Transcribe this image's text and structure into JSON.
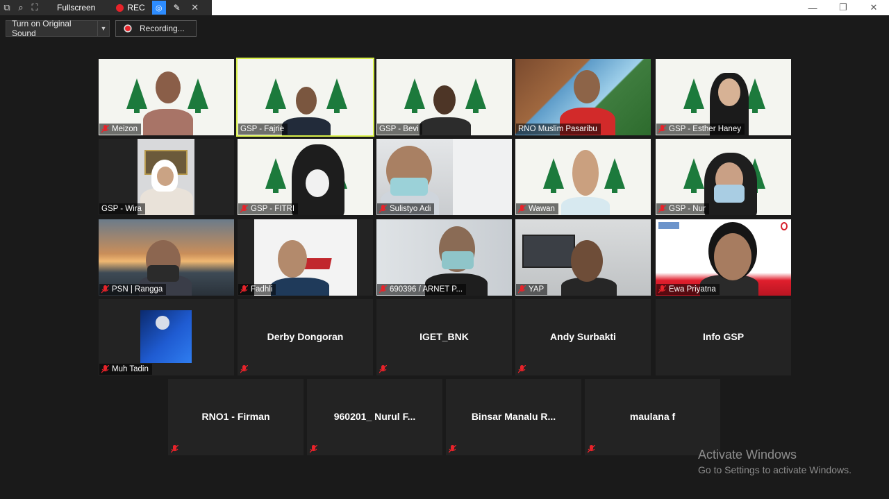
{
  "title_bar": {
    "fullscreen_label": "Fullscreen",
    "rec_label": "REC"
  },
  "toolbar": {
    "original_sound_label": "Turn on Original Sound",
    "recording_label": "Recording..."
  },
  "video_tiles": [
    {
      "name": "Meizon",
      "muted": true
    },
    {
      "name": "GSP - Fajrie",
      "muted": false,
      "active_speaker": true
    },
    {
      "name": "GSP - Bevi",
      "muted": false
    },
    {
      "name": "RNO Muslim Pasaribu",
      "muted": false
    },
    {
      "name": "GSP - Esther Haney",
      "muted": true
    },
    {
      "name": "GSP - Wira",
      "muted": false
    },
    {
      "name": "GSP - FITRI",
      "muted": true
    },
    {
      "name": "Sulistyo Adi",
      "muted": true
    },
    {
      "name": "Wawan",
      "muted": true
    },
    {
      "name": "GSP - Nur",
      "muted": true
    },
    {
      "name": "PSN | Rangga",
      "muted": true
    },
    {
      "name": "Fadhli",
      "muted": true
    },
    {
      "name": "690396 / ARNET P...",
      "muted": true
    },
    {
      "name": "YAP",
      "muted": true
    },
    {
      "name": "Ewa Priyatna",
      "muted": true
    },
    {
      "name": "Muh Tadin",
      "muted": true
    }
  ],
  "name_tiles": [
    {
      "name": "Derby Dongoran",
      "muted": true
    },
    {
      "name": "IGET_BNK",
      "muted": true
    },
    {
      "name": "Andy Surbakti",
      "muted": true
    },
    {
      "name": "Info GSP",
      "muted": false
    },
    {
      "name": "RNO1 - Firman",
      "muted": true
    },
    {
      "name": "960201_ Nurul F...",
      "muted": true
    },
    {
      "name": "Binsar Manalu R...",
      "muted": true
    },
    {
      "name": "maulana f",
      "muted": true
    }
  ],
  "watermark": {
    "line1": "Activate Windows",
    "line2": "Go to Settings to activate Windows."
  },
  "colors": {
    "background": "#1a1a1a",
    "tile": "#232323",
    "active_speaker_border": "#d9f04a",
    "muted_red": "#e8232a",
    "gsp_green": "#1c7a3c"
  }
}
